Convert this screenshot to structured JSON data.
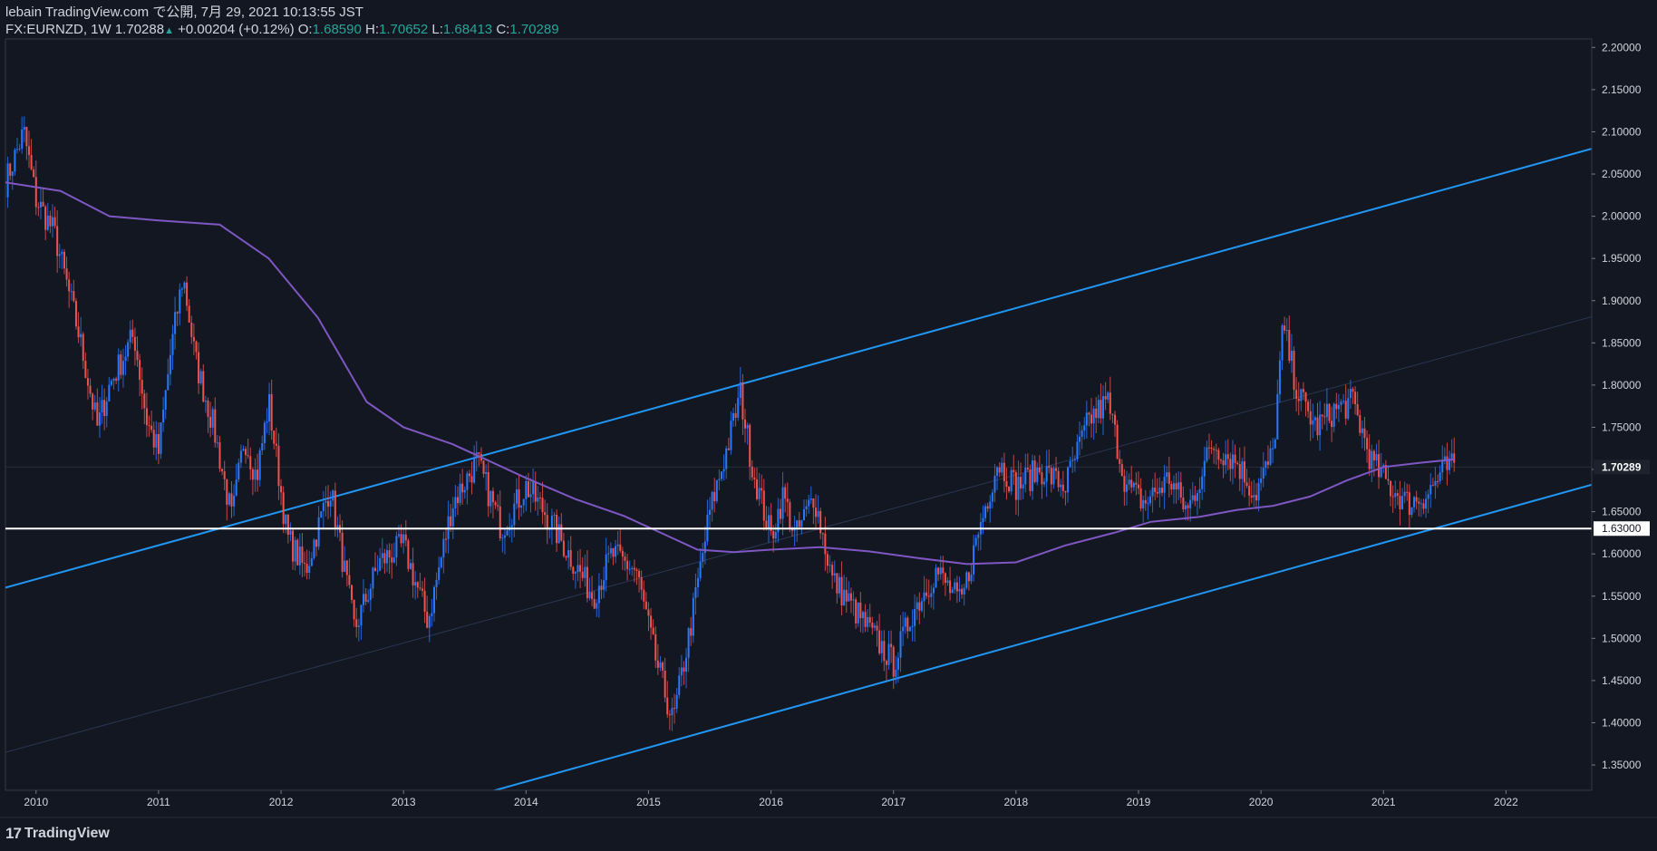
{
  "header": {
    "line1": "lebain TradingView.com で公開, 7月 29, 2021 10:13:55 JST",
    "symbol": "FX:EURNZD, 1W",
    "last": "1.70288",
    "change": "+0.00204 (+0.12%)",
    "o_label": "O:",
    "o_value": "1.68590",
    "h_label": "H:",
    "h_value": "1.70652",
    "l_label": "L:",
    "l_value": "1.68413",
    "c_label": "C:",
    "c_value": "1.70289"
  },
  "logo": {
    "mark": "17",
    "text": "TradingView"
  },
  "colors": {
    "background": "#131722",
    "up": "#2979ff",
    "down": "#ef5350",
    "ma": "#7e57c2",
    "channel": "#2196f3",
    "hline": "#ffffff",
    "text": "#d1d4dc"
  },
  "chart_data": {
    "type": "candlestick",
    "symbol": "FX:EURNZD",
    "interval": "1W",
    "ylim": [
      1.32,
      2.21
    ],
    "xlim": [
      2009.75,
      2022.7
    ],
    "y_ticks": [
      "2.20000",
      "2.15000",
      "2.10000",
      "2.05000",
      "2.00000",
      "1.95000",
      "1.90000",
      "1.85000",
      "1.80000",
      "1.75000",
      "1.70000",
      "1.65000",
      "1.60000",
      "1.55000",
      "1.50000",
      "1.45000",
      "1.40000",
      "1.35000"
    ],
    "x_ticks": [
      "2010",
      "2011",
      "2012",
      "2013",
      "2014",
      "2015",
      "2016",
      "2017",
      "2018",
      "2019",
      "2020",
      "2021",
      "2022"
    ],
    "price_labels": {
      "last": {
        "text": "1.70289",
        "value": 1.70289
      },
      "level": {
        "text": "1.63000",
        "value": 1.63
      }
    },
    "path": [
      [
        2009.75,
        2.04
      ],
      [
        2009.9,
        2.1
      ],
      [
        2010.0,
        2.02
      ],
      [
        2010.15,
        1.98
      ],
      [
        2010.35,
        1.86
      ],
      [
        2010.5,
        1.75
      ],
      [
        2010.6,
        1.8
      ],
      [
        2010.8,
        1.86
      ],
      [
        2010.9,
        1.76
      ],
      [
        2011.0,
        1.72
      ],
      [
        2011.1,
        1.84
      ],
      [
        2011.2,
        1.93
      ],
      [
        2011.3,
        1.83
      ],
      [
        2011.45,
        1.75
      ],
      [
        2011.6,
        1.64
      ],
      [
        2011.7,
        1.74
      ],
      [
        2011.8,
        1.69
      ],
      [
        2011.9,
        1.78
      ],
      [
        2012.05,
        1.62
      ],
      [
        2012.2,
        1.58
      ],
      [
        2012.4,
        1.68
      ],
      [
        2012.6,
        1.51
      ],
      [
        2012.8,
        1.59
      ],
      [
        2013.0,
        1.61
      ],
      [
        2013.2,
        1.52
      ],
      [
        2013.4,
        1.66
      ],
      [
        2013.6,
        1.71
      ],
      [
        2013.8,
        1.63
      ],
      [
        2014.0,
        1.68
      ],
      [
        2014.15,
        1.65
      ],
      [
        2014.35,
        1.6
      ],
      [
        2014.55,
        1.55
      ],
      [
        2014.7,
        1.6
      ],
      [
        2014.9,
        1.58
      ],
      [
        2015.05,
        1.48
      ],
      [
        2015.2,
        1.4
      ],
      [
        2015.35,
        1.52
      ],
      [
        2015.5,
        1.65
      ],
      [
        2015.65,
        1.73
      ],
      [
        2015.75,
        1.79
      ],
      [
        2015.85,
        1.7
      ],
      [
        2016.0,
        1.62
      ],
      [
        2016.1,
        1.67
      ],
      [
        2016.2,
        1.62
      ],
      [
        2016.35,
        1.67
      ],
      [
        2016.5,
        1.57
      ],
      [
        2016.7,
        1.53
      ],
      [
        2016.9,
        1.49
      ],
      [
        2017.0,
        1.47
      ],
      [
        2017.15,
        1.53
      ],
      [
        2017.35,
        1.58
      ],
      [
        2017.55,
        1.54
      ],
      [
        2017.7,
        1.63
      ],
      [
        2017.85,
        1.71
      ],
      [
        2018.0,
        1.68
      ],
      [
        2018.2,
        1.7
      ],
      [
        2018.4,
        1.68
      ],
      [
        2018.6,
        1.76
      ],
      [
        2018.75,
        1.78
      ],
      [
        2018.9,
        1.68
      ],
      [
        2019.05,
        1.66
      ],
      [
        2019.25,
        1.69
      ],
      [
        2019.4,
        1.65
      ],
      [
        2019.6,
        1.73
      ],
      [
        2019.8,
        1.71
      ],
      [
        2019.95,
        1.67
      ],
      [
        2020.1,
        1.72
      ],
      [
        2020.18,
        1.87
      ],
      [
        2020.3,
        1.79
      ],
      [
        2020.45,
        1.75
      ],
      [
        2020.6,
        1.77
      ],
      [
        2020.75,
        1.78
      ],
      [
        2020.9,
        1.71
      ],
      [
        2021.05,
        1.68
      ],
      [
        2021.2,
        1.66
      ],
      [
        2021.35,
        1.67
      ],
      [
        2021.5,
        1.7
      ],
      [
        2021.58,
        1.703
      ]
    ],
    "moving_average": [
      [
        2009.75,
        2.04
      ],
      [
        2010.2,
        2.03
      ],
      [
        2010.6,
        2.0
      ],
      [
        2011.0,
        1.995
      ],
      [
        2011.5,
        1.99
      ],
      [
        2011.9,
        1.95
      ],
      [
        2012.3,
        1.88
      ],
      [
        2012.7,
        1.78
      ],
      [
        2013.0,
        1.75
      ],
      [
        2013.4,
        1.73
      ],
      [
        2013.7,
        1.71
      ],
      [
        2014.0,
        1.69
      ],
      [
        2014.4,
        1.665
      ],
      [
        2014.8,
        1.645
      ],
      [
        2015.1,
        1.625
      ],
      [
        2015.4,
        1.605
      ],
      [
        2015.7,
        1.602
      ],
      [
        2016.0,
        1.605
      ],
      [
        2016.4,
        1.608
      ],
      [
        2016.8,
        1.603
      ],
      [
        2017.2,
        1.595
      ],
      [
        2017.6,
        1.588
      ],
      [
        2018.0,
        1.59
      ],
      [
        2018.4,
        1.61
      ],
      [
        2018.8,
        1.625
      ],
      [
        2019.1,
        1.638
      ],
      [
        2019.5,
        1.644
      ],
      [
        2019.8,
        1.652
      ],
      [
        2020.1,
        1.657
      ],
      [
        2020.4,
        1.668
      ],
      [
        2020.7,
        1.687
      ],
      [
        2021.0,
        1.703
      ],
      [
        2021.3,
        1.708
      ],
      [
        2021.58,
        1.712
      ]
    ],
    "channel": {
      "upper": [
        [
          2009.75,
          1.56
        ],
        [
          2022.7,
          2.08
        ]
      ],
      "lower": [
        [
          2013.5,
          1.31
        ],
        [
          2022.7,
          1.682
        ]
      ],
      "mid": [
        [
          2009.75,
          1.365
        ],
        [
          2022.7,
          1.881
        ]
      ]
    },
    "horizontal_level": 1.63,
    "grid": false
  }
}
